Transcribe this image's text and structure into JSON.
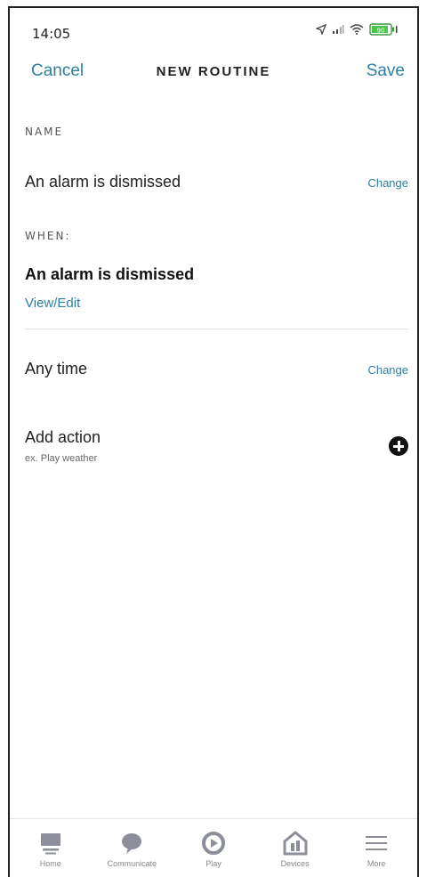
{
  "status_bar": {
    "time": "14:05",
    "icons": [
      "location-arrow-icon",
      "signal-icon",
      "wifi-icon",
      "battery-icon"
    ],
    "battery_level": 0.9,
    "battery_label": "90"
  },
  "header": {
    "cancel_label": "Cancel",
    "title": "NEW ROUTINE",
    "save_label": "Save"
  },
  "name_section": {
    "label": "NAME",
    "value": "An alarm is dismissed",
    "change_label": "Change"
  },
  "when_section": {
    "label": "WHEN:",
    "trigger": "An alarm is dismissed",
    "view_edit_label": "View/Edit"
  },
  "time_row": {
    "value": "Any time",
    "change_label": "Change"
  },
  "action_row": {
    "title": "Add action",
    "hint": "ex. Play weather",
    "add_icon": "plus-circle-icon"
  },
  "tab_bar": {
    "tabs": [
      {
        "label": "Home",
        "icon": "home-icon"
      },
      {
        "label": "Communicate",
        "icon": "chat-bubble-icon"
      },
      {
        "label": "Play",
        "icon": "play-icon"
      },
      {
        "label": "Devices",
        "icon": "devices-icon"
      },
      {
        "label": "More",
        "icon": "menu-icon"
      }
    ]
  },
  "colors": {
    "accent": "#2f7fa1",
    "text": "#222222",
    "muted": "#888888",
    "background": "#ffffff"
  }
}
